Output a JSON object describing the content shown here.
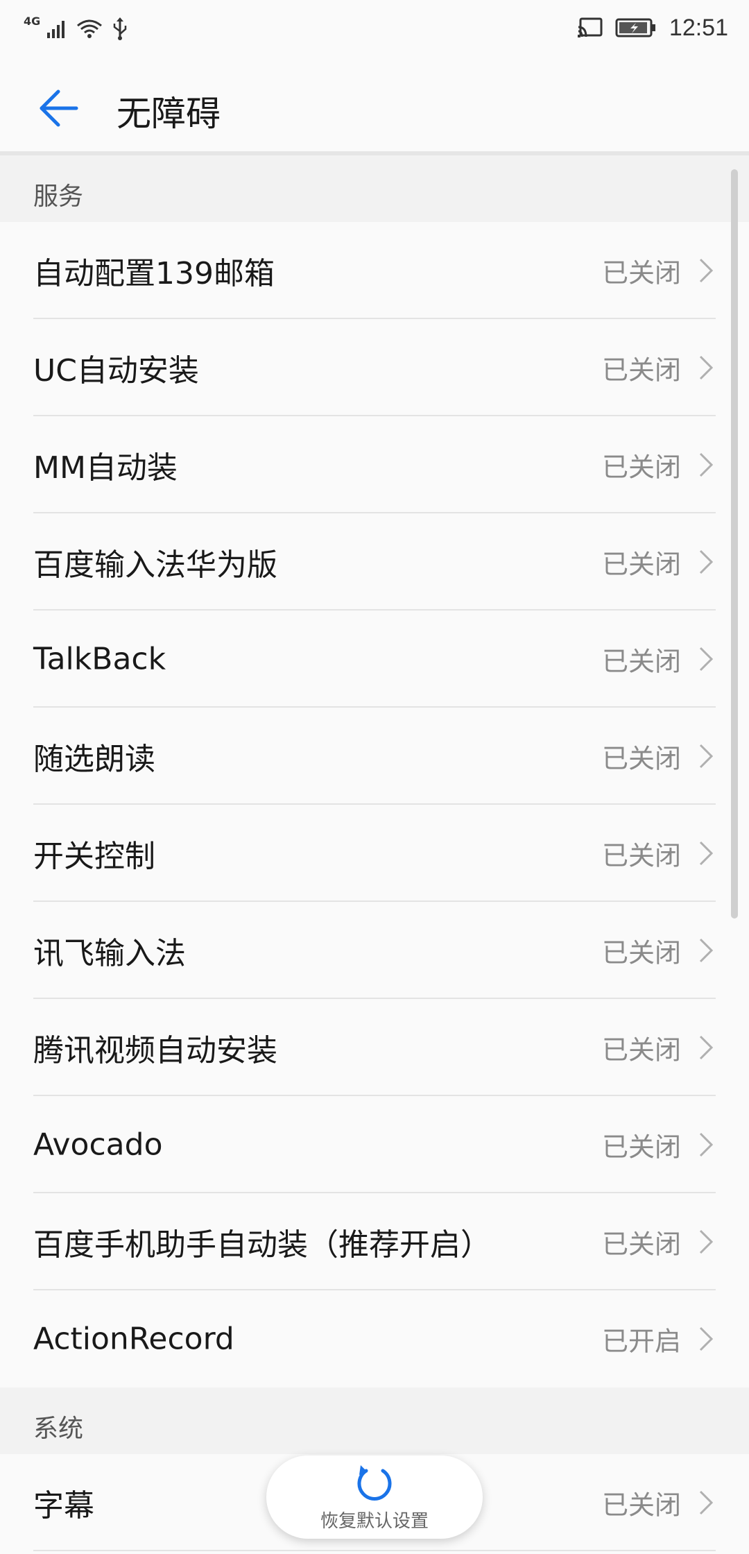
{
  "status_bar": {
    "network": "4G",
    "time": "12:51"
  },
  "header": {
    "title": "无障碍"
  },
  "sections": [
    {
      "title": "服务",
      "items": [
        {
          "label": "自动配置139邮箱",
          "status": "已关闭"
        },
        {
          "label": "UC自动安装",
          "status": "已关闭"
        },
        {
          "label": "MM自动装",
          "status": "已关闭"
        },
        {
          "label": "百度输入法华为版",
          "status": "已关闭"
        },
        {
          "label": "TalkBack",
          "status": "已关闭"
        },
        {
          "label": "随选朗读",
          "status": "已关闭"
        },
        {
          "label": "开关控制",
          "status": "已关闭"
        },
        {
          "label": "讯飞输入法",
          "status": "已关闭"
        },
        {
          "label": "腾讯视频自动安装",
          "status": "已关闭"
        },
        {
          "label": "Avocado",
          "status": "已关闭"
        },
        {
          "label": "百度手机助手自动装（推荐开启）",
          "status": "已关闭"
        },
        {
          "label": "ActionRecord",
          "status": "已开启"
        }
      ]
    },
    {
      "title": "系统",
      "items": [
        {
          "label": "字幕",
          "status": "已关闭"
        }
      ]
    }
  ],
  "restore_button": {
    "label": "恢复默认设置"
  },
  "colors": {
    "accent": "#1a73e8",
    "background": "#fafafa",
    "section_bg": "#f2f2f2"
  }
}
